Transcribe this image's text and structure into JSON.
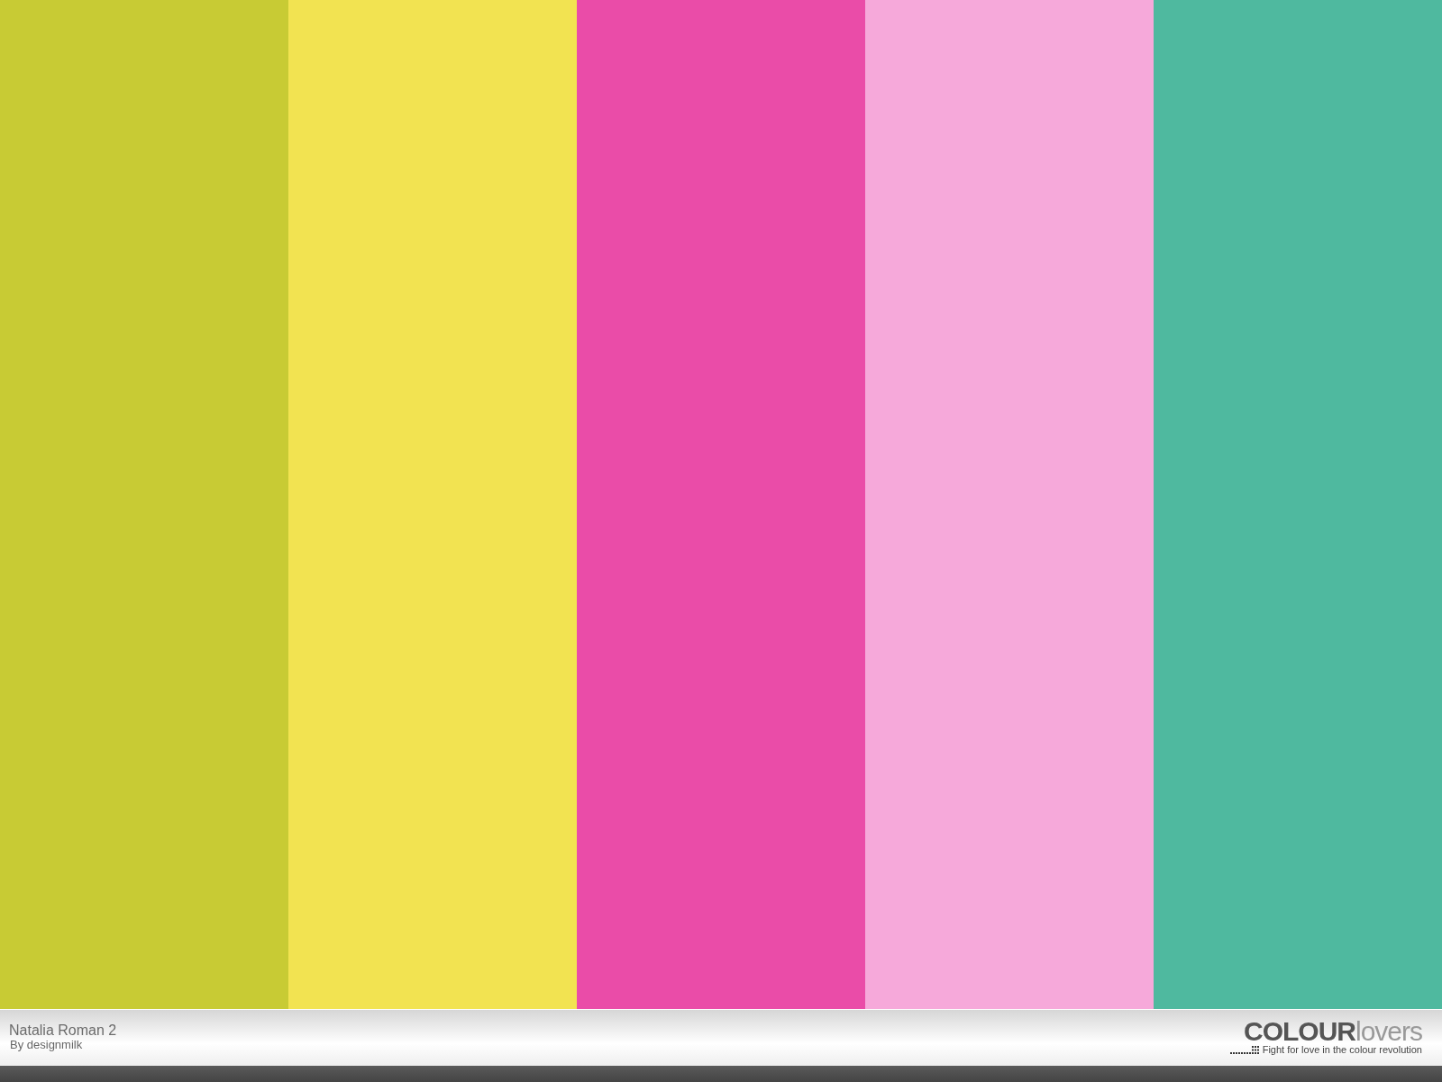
{
  "swatches": [
    {
      "color": "#c8cb34"
    },
    {
      "color": "#f2e351"
    },
    {
      "color": "#ea4ca8"
    },
    {
      "color": "#f6a9da"
    },
    {
      "color": "#4fb99f"
    }
  ],
  "footer": {
    "title": "Natalia Roman 2",
    "author": "By designmilk",
    "logo": "**COLOUR**lovers",
    "tagline": "Fight for love in the colour revolution"
  }
}
